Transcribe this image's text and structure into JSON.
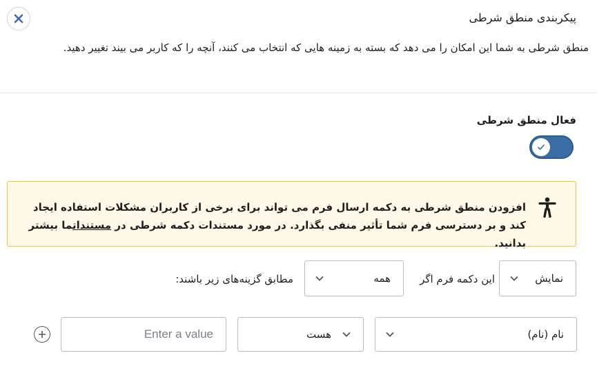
{
  "panel": {
    "title": "پیکربندی منطق شرطی",
    "description": "منطق شرطی به شما این امکان را می دهد که بسته به زمینه هایی که انتخاب می کنند، آنچه را که کاربر می بیند تغییر دهید.",
    "close_icon": "close-icon"
  },
  "toggle": {
    "label": "فعال منطق شرطی",
    "checked": true,
    "accent": "#3b6ea5"
  },
  "notice": {
    "icon": "accessibility-icon",
    "text_before_link": "افزودن منطق شرطی به دکمه ارسال فرم می تواند برای برخی از کاربران مشکلات استفاده ایجاد کند و بر دسترسی فرم شما تأثیر منفی بگذارد. در مورد مستندات دکمه شرطی در ",
    "link_text": "مستندات",
    "text_after_link": "ما بیشتر بدانید.",
    "border_color": "#f0c33c",
    "background": "#fff9e8"
  },
  "rule_row": {
    "action_select": "نمایش",
    "text_1": "این دکمه فرم اگر",
    "match_select": "همه",
    "text_2": "مطابق گزینه‌های زیر باشند:"
  },
  "condition_row": {
    "field_select": "نام (نام)",
    "operator_select": "هست",
    "value_placeholder": "Enter a value",
    "add_icon": "plus-icon"
  }
}
